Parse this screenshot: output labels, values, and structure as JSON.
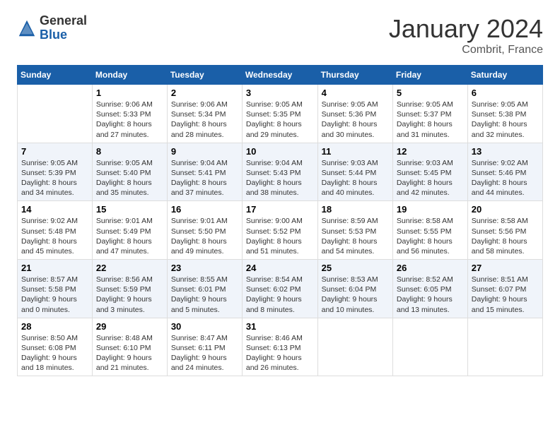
{
  "logo": {
    "general": "General",
    "blue": "Blue"
  },
  "header": {
    "month": "January 2024",
    "location": "Combrit, France"
  },
  "weekdays": [
    "Sunday",
    "Monday",
    "Tuesday",
    "Wednesday",
    "Thursday",
    "Friday",
    "Saturday"
  ],
  "weeks": [
    [
      {
        "day": "",
        "info": ""
      },
      {
        "day": "1",
        "info": "Sunrise: 9:06 AM\nSunset: 5:33 PM\nDaylight: 8 hours\nand 27 minutes."
      },
      {
        "day": "2",
        "info": "Sunrise: 9:06 AM\nSunset: 5:34 PM\nDaylight: 8 hours\nand 28 minutes."
      },
      {
        "day": "3",
        "info": "Sunrise: 9:05 AM\nSunset: 5:35 PM\nDaylight: 8 hours\nand 29 minutes."
      },
      {
        "day": "4",
        "info": "Sunrise: 9:05 AM\nSunset: 5:36 PM\nDaylight: 8 hours\nand 30 minutes."
      },
      {
        "day": "5",
        "info": "Sunrise: 9:05 AM\nSunset: 5:37 PM\nDaylight: 8 hours\nand 31 minutes."
      },
      {
        "day": "6",
        "info": "Sunrise: 9:05 AM\nSunset: 5:38 PM\nDaylight: 8 hours\nand 32 minutes."
      }
    ],
    [
      {
        "day": "7",
        "info": "Sunrise: 9:05 AM\nSunset: 5:39 PM\nDaylight: 8 hours\nand 34 minutes."
      },
      {
        "day": "8",
        "info": "Sunrise: 9:05 AM\nSunset: 5:40 PM\nDaylight: 8 hours\nand 35 minutes."
      },
      {
        "day": "9",
        "info": "Sunrise: 9:04 AM\nSunset: 5:41 PM\nDaylight: 8 hours\nand 37 minutes."
      },
      {
        "day": "10",
        "info": "Sunrise: 9:04 AM\nSunset: 5:43 PM\nDaylight: 8 hours\nand 38 minutes."
      },
      {
        "day": "11",
        "info": "Sunrise: 9:03 AM\nSunset: 5:44 PM\nDaylight: 8 hours\nand 40 minutes."
      },
      {
        "day": "12",
        "info": "Sunrise: 9:03 AM\nSunset: 5:45 PM\nDaylight: 8 hours\nand 42 minutes."
      },
      {
        "day": "13",
        "info": "Sunrise: 9:02 AM\nSunset: 5:46 PM\nDaylight: 8 hours\nand 44 minutes."
      }
    ],
    [
      {
        "day": "14",
        "info": "Sunrise: 9:02 AM\nSunset: 5:48 PM\nDaylight: 8 hours\nand 45 minutes."
      },
      {
        "day": "15",
        "info": "Sunrise: 9:01 AM\nSunset: 5:49 PM\nDaylight: 8 hours\nand 47 minutes."
      },
      {
        "day": "16",
        "info": "Sunrise: 9:01 AM\nSunset: 5:50 PM\nDaylight: 8 hours\nand 49 minutes."
      },
      {
        "day": "17",
        "info": "Sunrise: 9:00 AM\nSunset: 5:52 PM\nDaylight: 8 hours\nand 51 minutes."
      },
      {
        "day": "18",
        "info": "Sunrise: 8:59 AM\nSunset: 5:53 PM\nDaylight: 8 hours\nand 54 minutes."
      },
      {
        "day": "19",
        "info": "Sunrise: 8:58 AM\nSunset: 5:55 PM\nDaylight: 8 hours\nand 56 minutes."
      },
      {
        "day": "20",
        "info": "Sunrise: 8:58 AM\nSunset: 5:56 PM\nDaylight: 8 hours\nand 58 minutes."
      }
    ],
    [
      {
        "day": "21",
        "info": "Sunrise: 8:57 AM\nSunset: 5:58 PM\nDaylight: 9 hours\nand 0 minutes."
      },
      {
        "day": "22",
        "info": "Sunrise: 8:56 AM\nSunset: 5:59 PM\nDaylight: 9 hours\nand 3 minutes."
      },
      {
        "day": "23",
        "info": "Sunrise: 8:55 AM\nSunset: 6:01 PM\nDaylight: 9 hours\nand 5 minutes."
      },
      {
        "day": "24",
        "info": "Sunrise: 8:54 AM\nSunset: 6:02 PM\nDaylight: 9 hours\nand 8 minutes."
      },
      {
        "day": "25",
        "info": "Sunrise: 8:53 AM\nSunset: 6:04 PM\nDaylight: 9 hours\nand 10 minutes."
      },
      {
        "day": "26",
        "info": "Sunrise: 8:52 AM\nSunset: 6:05 PM\nDaylight: 9 hours\nand 13 minutes."
      },
      {
        "day": "27",
        "info": "Sunrise: 8:51 AM\nSunset: 6:07 PM\nDaylight: 9 hours\nand 15 minutes."
      }
    ],
    [
      {
        "day": "28",
        "info": "Sunrise: 8:50 AM\nSunset: 6:08 PM\nDaylight: 9 hours\nand 18 minutes."
      },
      {
        "day": "29",
        "info": "Sunrise: 8:48 AM\nSunset: 6:10 PM\nDaylight: 9 hours\nand 21 minutes."
      },
      {
        "day": "30",
        "info": "Sunrise: 8:47 AM\nSunset: 6:11 PM\nDaylight: 9 hours\nand 24 minutes."
      },
      {
        "day": "31",
        "info": "Sunrise: 8:46 AM\nSunset: 6:13 PM\nDaylight: 9 hours\nand 26 minutes."
      },
      {
        "day": "",
        "info": ""
      },
      {
        "day": "",
        "info": ""
      },
      {
        "day": "",
        "info": ""
      }
    ]
  ]
}
